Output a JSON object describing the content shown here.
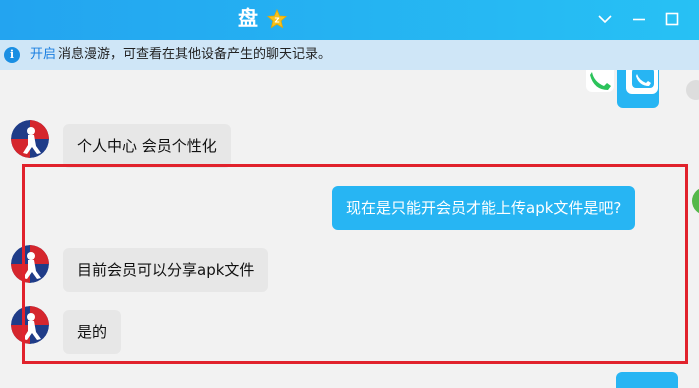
{
  "titlebar": {
    "title": "盘",
    "colors": {
      "start": "#23a4f0",
      "end": "#27c1f4"
    }
  },
  "notice": {
    "icon": "info-icon",
    "link_label": "开启",
    "text": "消息漫游，可查看在其他设备产生的聊天记录。"
  },
  "messages": [
    {
      "direction": "in",
      "text": "个人中心 会员个性化"
    },
    {
      "direction": "out",
      "text": "现在是只能开会员才能上传apk文件是吧?"
    },
    {
      "direction": "in",
      "text": "目前会员可以分享apk文件"
    },
    {
      "direction": "in",
      "text": "是的"
    }
  ],
  "colors": {
    "incoming_bubble": "#e7e7e7",
    "outgoing_bubble": "#27b5f3",
    "highlight_border": "#e1222c",
    "notice_bg": "#cfe6f7"
  }
}
